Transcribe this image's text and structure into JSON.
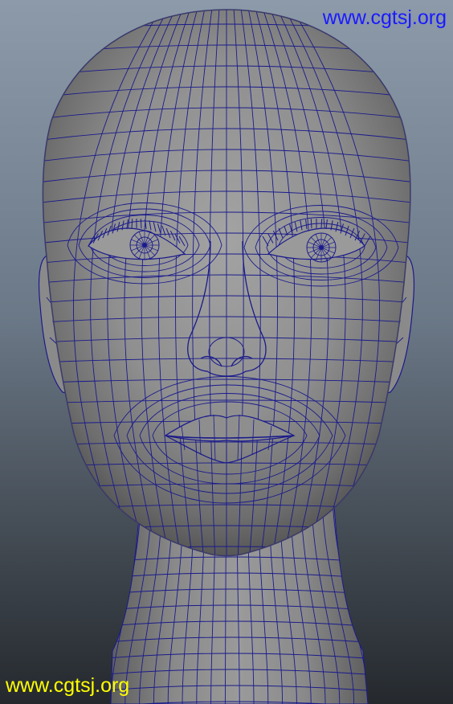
{
  "viewport": {
    "background_top": "#8c9aaa",
    "background_bottom": "#25292e"
  },
  "model": {
    "surface_color": "#8f8f8f",
    "wireframe_color": "#1a1a8c",
    "icon": "polygon-head-wireframe"
  },
  "watermarks": {
    "top": {
      "text": "www.cgtsj.org",
      "color": "#1a1aff"
    },
    "bottom": {
      "text": "www.cgtsj.org",
      "color": "#ffff00"
    }
  }
}
